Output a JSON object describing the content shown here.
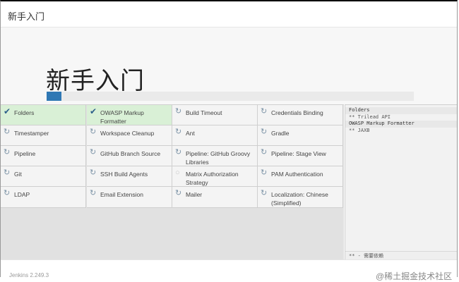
{
  "header": {
    "title": "新手入门"
  },
  "hero": {
    "title": "新手入门",
    "progress_percent": 4
  },
  "plugins": [
    {
      "label": "Folders",
      "status": "done"
    },
    {
      "label": "OWASP Markup Formatter",
      "status": "done"
    },
    {
      "label": "Build Timeout",
      "status": "installing"
    },
    {
      "label": "Credentials Binding",
      "status": "installing"
    },
    {
      "label": "Timestamper",
      "status": "installing"
    },
    {
      "label": "Workspace Cleanup",
      "status": "installing"
    },
    {
      "label": "Ant",
      "status": "installing"
    },
    {
      "label": "Gradle",
      "status": "installing"
    },
    {
      "label": "Pipeline",
      "status": "installing"
    },
    {
      "label": "GitHub Branch Source",
      "status": "installing"
    },
    {
      "label": "Pipeline: GitHub Groovy Libraries",
      "status": "installing"
    },
    {
      "label": "Pipeline: Stage View",
      "status": "installing"
    },
    {
      "label": "Git",
      "status": "installing"
    },
    {
      "label": "SSH Build Agents",
      "status": "installing"
    },
    {
      "label": "Matrix Authorization Strategy",
      "status": "pending"
    },
    {
      "label": "PAM Authentication",
      "status": "installing"
    },
    {
      "label": "LDAP",
      "status": "installing"
    },
    {
      "label": "Email Extension",
      "status": "installing"
    },
    {
      "label": "Mailer",
      "status": "installing"
    },
    {
      "label": "Localization: Chinese (Simplified)",
      "status": "installing"
    }
  ],
  "log": {
    "lines": [
      "Folders",
      "** Trilead API",
      "OWASP Markup Formatter",
      "** JAXB"
    ],
    "footer": "** - 需要依赖"
  },
  "footer": {
    "version": "Jenkins 2.249.3",
    "brand": "@稀土掘金技术社区"
  },
  "colors": {
    "done_bg": "#d9f0d6",
    "progress": "#2f78b4",
    "icon": "#7e95a8"
  }
}
